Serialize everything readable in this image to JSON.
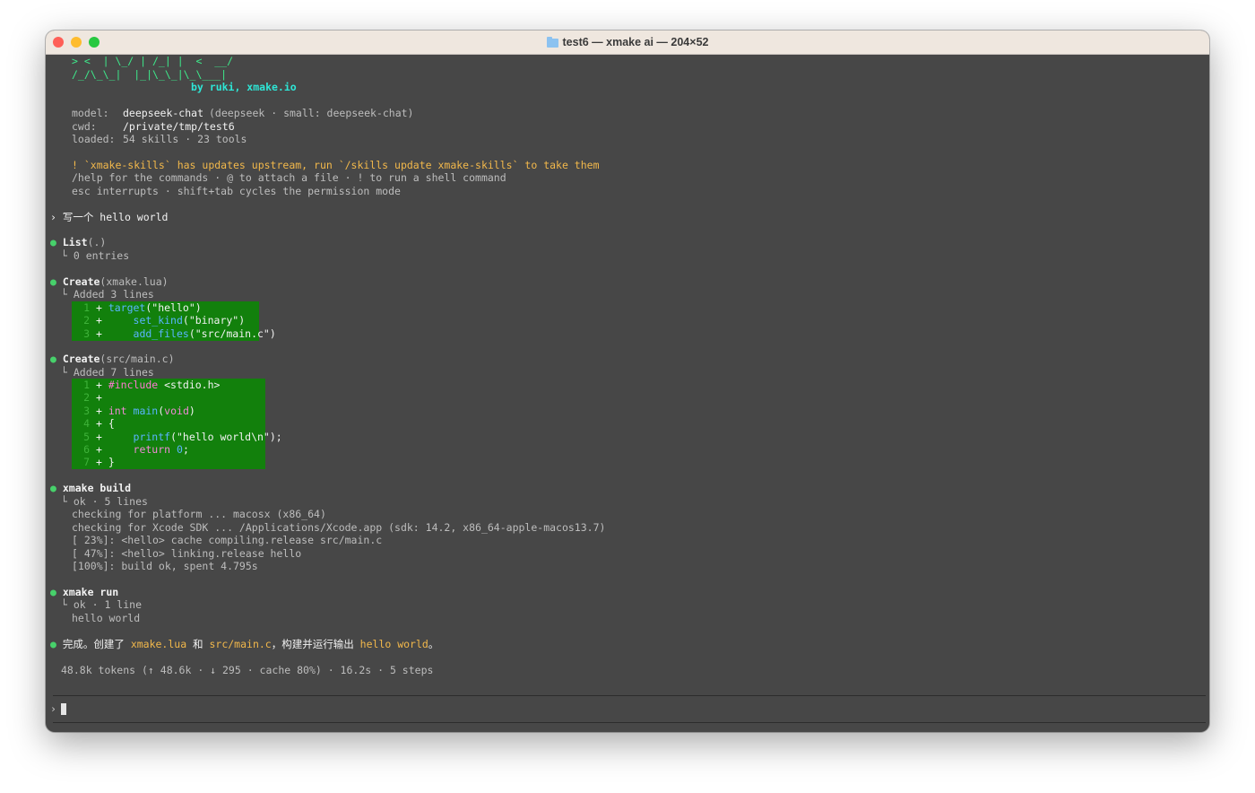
{
  "window": {
    "title": "test6 — xmake ai — 204×52"
  },
  "banner": {
    "art_line1": "> <  | \\_/ | /_| |  <  __/",
    "art_line2": "/_/\\_\\_|  |_|\\_\\_|\\_\\___|",
    "byline": "by ruki, xmake.io"
  },
  "info": {
    "model_label": "model:",
    "model_value": "deepseek-chat",
    "model_detail": "(deepseek · small: deepseek-chat)",
    "cwd_label": "cwd:",
    "cwd_value": "/private/tmp/test6",
    "loaded_label": "loaded:",
    "loaded_value": "54 skills · 23 tools"
  },
  "notice": "! `xmake-skills` has updates upstream, run `/skills update xmake-skills` to take them",
  "help_line1": "/help for the commands · @ to attach a file · ! to run a shell command",
  "help_line2": "esc interrupts · shift+tab cycles the permission mode",
  "user_prompt": "› 写一个 hello world",
  "steps": [
    {
      "name": "List",
      "arg": "(.)",
      "result": "└ 0 entries"
    },
    {
      "name": "Create",
      "arg": "(xmake.lua)",
      "result": "└ Added 3 lines",
      "lines": [
        {
          "n": "1",
          "code": "target(\"hello\")"
        },
        {
          "n": "2",
          "code": "    set_kind(\"binary\")"
        },
        {
          "n": "3",
          "code": "    add_files(\"src/main.c\")"
        }
      ]
    },
    {
      "name": "Create",
      "arg": "(src/main.c)",
      "result": "└ Added 7 lines",
      "lines": [
        {
          "n": "1",
          "code": "#include <stdio.h>"
        },
        {
          "n": "2",
          "code": ""
        },
        {
          "n": "3",
          "code": "int main(void)"
        },
        {
          "n": "4",
          "code": "{"
        },
        {
          "n": "5",
          "code": "    printf(\"hello world\\n\");"
        },
        {
          "n": "6",
          "code": "    return 0;"
        },
        {
          "n": "7",
          "code": "}"
        }
      ]
    },
    {
      "name": "xmake build",
      "arg": "",
      "result": "└ ok · 5 lines",
      "output": [
        "checking for platform ... macosx (x86_64)",
        "checking for Xcode SDK ... /Applications/Xcode.app (sdk: 14.2, x86_64-apple-macos13.7)",
        "[ 23%]: <hello> cache compiling.release src/main.c",
        "[ 47%]: <hello> linking.release hello",
        "[100%]: build ok, spent 4.795s"
      ]
    },
    {
      "name": "xmake run",
      "arg": "",
      "result": "└ ok · 1 line",
      "output": [
        "hello world"
      ]
    }
  ],
  "summary": {
    "prefix": "完成。创建了 ",
    "file1": "xmake.lua",
    "and": " 和 ",
    "file2": "src/main.c",
    "mid": "，构建并运行输出 ",
    "out": "hello world",
    "end": "。"
  },
  "stats": "48.8k tokens (↑ 48.6k · ↓ 295 · cache 80%) · 16.2s · 5 steps",
  "input": {
    "prompt_char": "›",
    "value": ""
  },
  "colors": {
    "terminal_bg": "#474747",
    "diff_bg": "#12800c",
    "accent_green": "#3ee88a",
    "notice": "#f2b84b"
  }
}
